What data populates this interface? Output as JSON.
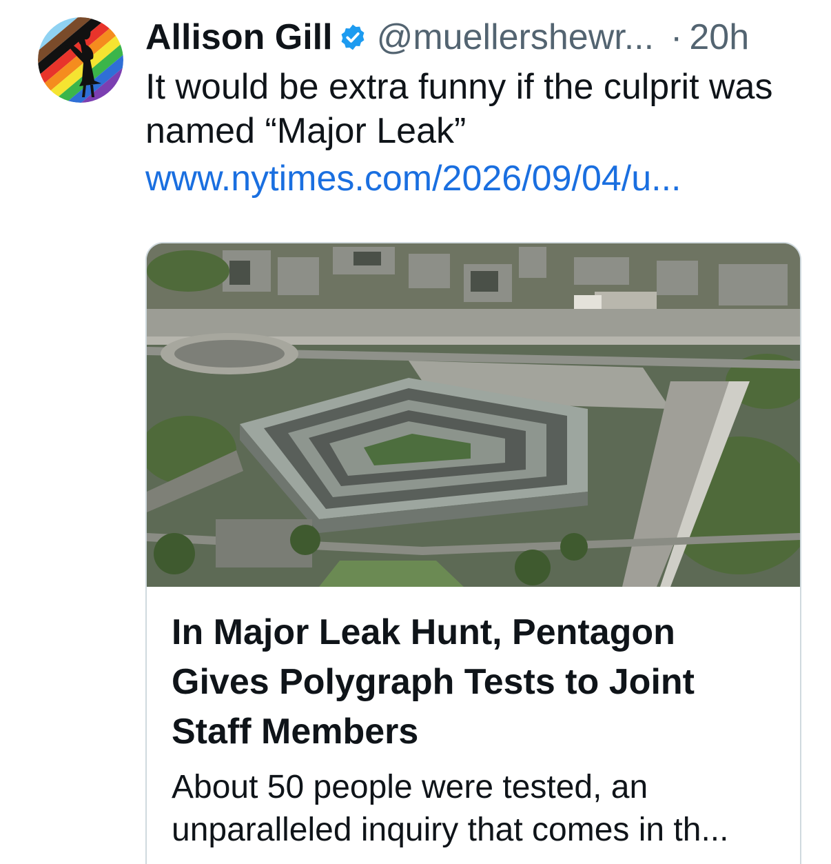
{
  "post": {
    "author": {
      "display_name": "Allison Gill",
      "handle": "@muellershewr...",
      "verified": true,
      "avatar": "rainbow-stripe-avatar-with-silhouette"
    },
    "separator": "·",
    "time": "20h",
    "text": "It would be extra funny if the culprit was named “Major Leak”",
    "link_text": "www.nytimes.com/2026/09/04/u..."
  },
  "card": {
    "image": "aerial-photo-of-pentagon",
    "title": "In Major Leak Hunt, Pentagon Gives Polygraph Tests to Joint Staff Members",
    "description": "About 50 people were tested, an unparalleled inquiry that comes in th..."
  },
  "colors": {
    "text": "#0f1419",
    "secondary": "#536471",
    "link": "#1a6fe0",
    "verified": "#1d9bf0",
    "card_border": "#cfd9de"
  }
}
